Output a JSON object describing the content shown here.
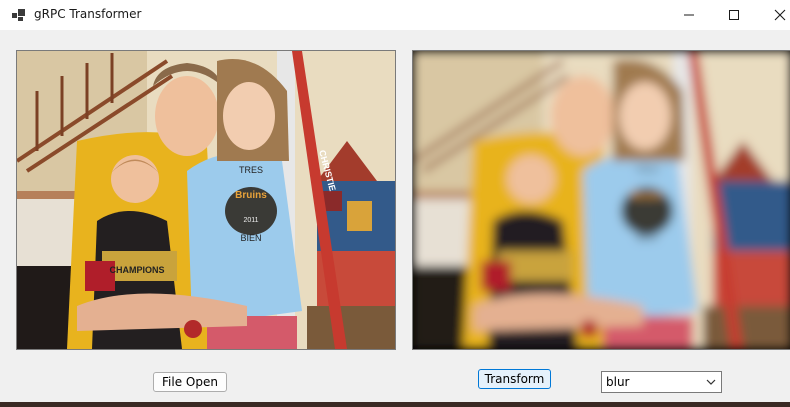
{
  "window": {
    "title": "gRPC Transformer",
    "icons": {
      "app": "app-icon",
      "minimize": "minimize-icon",
      "maximize": "maximize-icon",
      "close": "close-icon"
    }
  },
  "images": {
    "original": {
      "content": "family-photo",
      "state": "sharp"
    },
    "transformed": {
      "content": "family-photo",
      "state": "blurred"
    },
    "shirt_text": {
      "line1": "TRES",
      "logo": "Bruins",
      "year": "2011",
      "line2": "BIEN"
    },
    "stick_text": "CHRISTIE",
    "shirt_kid_text": "CHAMPIONS"
  },
  "controls": {
    "file_open_label": "File Open",
    "transform_label": "Transform",
    "transform_select": {
      "selected": "blur",
      "icon": "chevron-down-icon"
    }
  },
  "colors": {
    "accent": "#0078d7",
    "button_face": "#fdfdfd",
    "selected_button": "#e5f1fb"
  }
}
